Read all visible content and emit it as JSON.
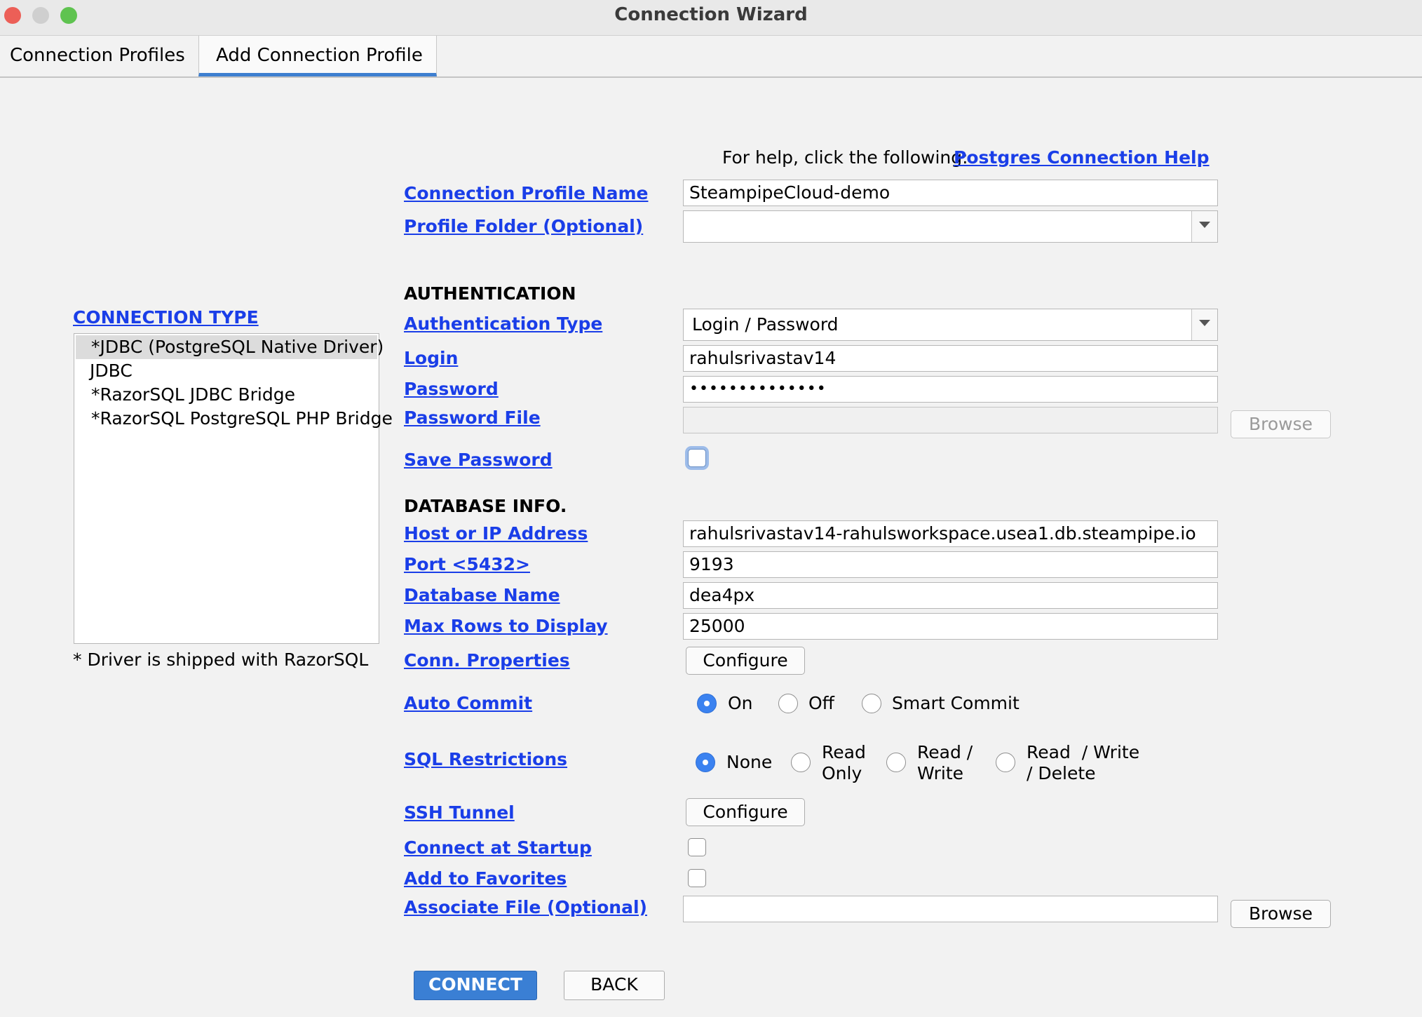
{
  "window": {
    "title": "Connection Wizard"
  },
  "tabs": [
    {
      "label": "Connection Profiles"
    },
    {
      "label": "Add Connection Profile"
    }
  ],
  "help": {
    "prefix": "For help, click the following:",
    "link": "Postgres Connection Help"
  },
  "connection_type": {
    "label": "CONNECTION TYPE",
    "items": [
      "*JDBC (PostgreSQL Native Driver)",
      "JDBC",
      "*RazorSQL JDBC Bridge",
      "*RazorSQL PostgreSQL PHP Bridge"
    ],
    "selected_index": 0,
    "note": "* Driver is shipped with RazorSQL"
  },
  "profile": {
    "name_label": "Connection Profile Name",
    "name_value": "SteampipeCloud-demo",
    "folder_label": "Profile Folder (Optional)",
    "folder_value": ""
  },
  "authentication": {
    "header": "AUTHENTICATION",
    "type_label": "Authentication Type",
    "type_value": "Login / Password",
    "login_label": "Login",
    "login_value": "rahulsrivastav14",
    "password_label": "Password",
    "password_value": "••••••••••••••",
    "password_file_label": "Password File",
    "password_file_value": "",
    "browse_label": "Browse",
    "save_password_label": "Save Password",
    "save_password_checked": false
  },
  "database": {
    "header": "DATABASE INFO.",
    "host_label": "Host or IP Address",
    "host_value": "rahulsrivastav14-rahulsworkspace.usea1.db.steampipe.io",
    "port_label": "Port <5432>",
    "port_value": "9193",
    "dbname_label": "Database Name",
    "dbname_value": "dea4px",
    "maxrows_label": "Max Rows to Display",
    "maxrows_value": "25000",
    "conn_props_label": "Conn. Properties",
    "configure_label": "Configure"
  },
  "auto_commit": {
    "label": "Auto Commit",
    "options": [
      "On",
      "Off",
      "Smart Commit"
    ],
    "selected": "On"
  },
  "sql_restrictions": {
    "label": "SQL Restrictions",
    "options": [
      {
        "line1": "None",
        "line2": ""
      },
      {
        "line1": "Read",
        "line2": "Only"
      },
      {
        "line1": "Read /",
        "line2": "Write"
      },
      {
        "line1": "Read  / Write",
        "line2": "/ Delete"
      }
    ],
    "selected": "None"
  },
  "ssh": {
    "label": "SSH Tunnel",
    "configure_label": "Configure"
  },
  "startup": {
    "label": "Connect at Startup",
    "checked": false
  },
  "favorites": {
    "label": "Add to Favorites",
    "checked": false
  },
  "associate": {
    "label": "Associate File (Optional)",
    "value": "",
    "browse_label": "Browse"
  },
  "actions": {
    "connect_label": "CONNECT",
    "back_label": "BACK"
  },
  "colors": {
    "link": "#1a3ee8",
    "accent": "#3a7fd4",
    "radio_selected": "#3b82f0"
  }
}
